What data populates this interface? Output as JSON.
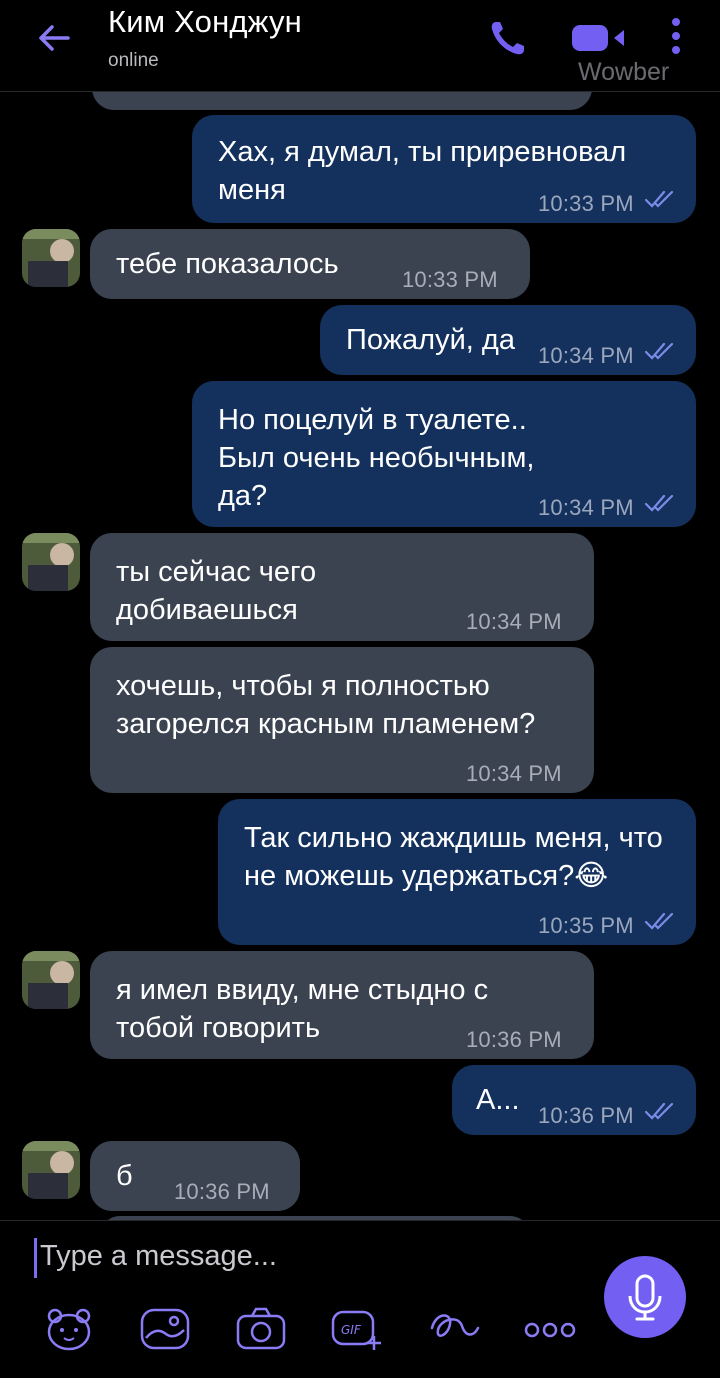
{
  "header": {
    "title": "Ким Хонджун",
    "status": "online",
    "watermark": "Wowber",
    "icons": [
      "back-arrow-icon",
      "phone-icon",
      "video-call-icon",
      "more-vertical-icon"
    ],
    "accent": "#7360f2"
  },
  "messages": [
    {
      "dir": "out",
      "text": "Хах, я думал, ты приревновал меня",
      "time": "10:33 PM"
    },
    {
      "dir": "in",
      "text": "тебе показалось",
      "time": "10:33 PM"
    },
    {
      "dir": "out",
      "text": "Пожалуй, да",
      "time": "10:34 PM"
    },
    {
      "dir": "out",
      "text": "Но поцелуй в туалете.. Был очень необычным, да?",
      "time": "10:34 PM"
    },
    {
      "dir": "in",
      "text": "ты сейчас чего добиваешься",
      "time": "10:34 PM"
    },
    {
      "dir": "in",
      "text": "хочешь, чтобы я полностью загорелся красным пламенем?",
      "time": "10:34 PM"
    },
    {
      "dir": "out",
      "text": "Так сильно жаждишь меня, что не можешь удержаться?😂",
      "time": "10:35 PM"
    },
    {
      "dir": "in",
      "text": "я имел ввиду, мне стыдно с тобой говорить",
      "time": "10:36 PM"
    },
    {
      "dir": "out",
      "text": "А...",
      "time": "10:36 PM"
    },
    {
      "dir": "in",
      "text": "б",
      "time": "10:36 PM"
    }
  ],
  "composer": {
    "placeholder": "Type a message...",
    "toolbar_icons": [
      "sticker-bear-icon",
      "image-gallery-icon",
      "camera-icon",
      "gif-icon",
      "doodle-icon",
      "more-horizontal-icon"
    ],
    "mic_icon": "microphone-icon"
  }
}
